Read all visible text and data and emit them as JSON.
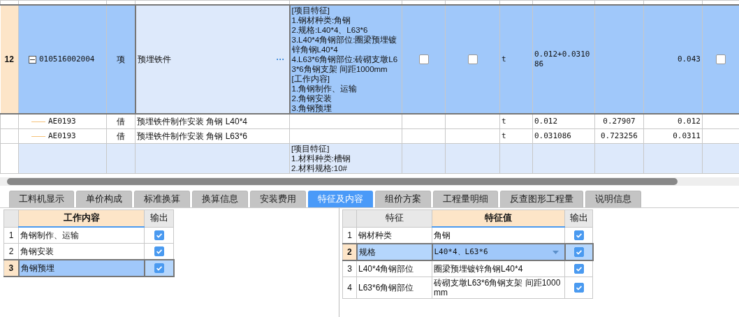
{
  "top_grid": {
    "rows": [
      {
        "row_number": "12",
        "selected": true,
        "expanded": true,
        "code": "010516002004",
        "type": "项",
        "name": "预埋铁件",
        "more": "···",
        "description": [
          "[项目特征]",
          "1.钢材种类:角钢",
          "2.规格:L40*4、L63*6",
          "3.L40*4角钢部位:圈梁预埋镀锌角钢L40*4",
          "4.L63*6角钢部位:砖砌支墩L63*6角钢支架 间距1000mm",
          "[工作内容]",
          "1.角钢制作、运输",
          "2.角钢安装",
          "3.角钢预埋"
        ],
        "check_1": false,
        "check_2": false,
        "unit": "t",
        "quantity_expression": "0.012+0.031086",
        "amount": "0.043",
        "check_3": false,
        "children": [
          {
            "code": "AE0193",
            "type": "借",
            "name": "预埋铁件制作安装 角钢 L40*4",
            "unit": "t",
            "quantity_expression": "0.012",
            "column_10": "0.27907",
            "amount": "0.012"
          },
          {
            "code": "AE0193",
            "type": "借",
            "name": "预埋铁件制作安装 角钢 L63*6",
            "unit": "t",
            "quantity_expression": "0.031086",
            "column_10": "0.723256",
            "amount": "0.0311"
          }
        ]
      },
      {
        "selected": false,
        "description": [
          "[项目特征]",
          "1.材料种类:槽钢",
          "2.材料规格:10#"
        ]
      }
    ]
  },
  "tabs": [
    {
      "label": "工料机显示",
      "selected": false
    },
    {
      "label": "单价构成",
      "selected": false
    },
    {
      "label": "标准换算",
      "selected": false
    },
    {
      "label": "换算信息",
      "selected": false
    },
    {
      "label": "安装费用",
      "selected": false
    },
    {
      "label": "特征及内容",
      "selected": true
    },
    {
      "label": "组价方案",
      "selected": false
    },
    {
      "label": "工程量明细",
      "selected": false
    },
    {
      "label": "反查图形工程量",
      "selected": false
    },
    {
      "label": "说明信息",
      "selected": false
    }
  ],
  "work_content": {
    "columns": [
      "工作内容",
      "输出"
    ],
    "rows": [
      {
        "number": "1",
        "text": "角钢制作、运输",
        "output": true,
        "selected": false
      },
      {
        "number": "2",
        "text": "角钢安装",
        "output": true,
        "selected": false
      },
      {
        "number": "3",
        "text": "角钢预埋",
        "output": true,
        "selected": true
      }
    ]
  },
  "features": {
    "columns": [
      "特征",
      "特征值",
      "输出"
    ],
    "rows": [
      {
        "number": "1",
        "feature": "钢材种类",
        "value": "角钢",
        "output": true,
        "selected": false
      },
      {
        "number": "2",
        "feature": "规格",
        "value": "L40*4、L63*6",
        "output": true,
        "selected": true
      },
      {
        "number": "3",
        "feature": "L40*4角钢部位",
        "value": "圈梁预埋镀锌角钢L40*4",
        "output": true,
        "selected": false
      },
      {
        "number": "4",
        "feature": "L63*6角钢部位",
        "value": "砖砌支墩L63*6角钢支架 间距1000mm",
        "output": true,
        "selected": false
      }
    ]
  }
}
